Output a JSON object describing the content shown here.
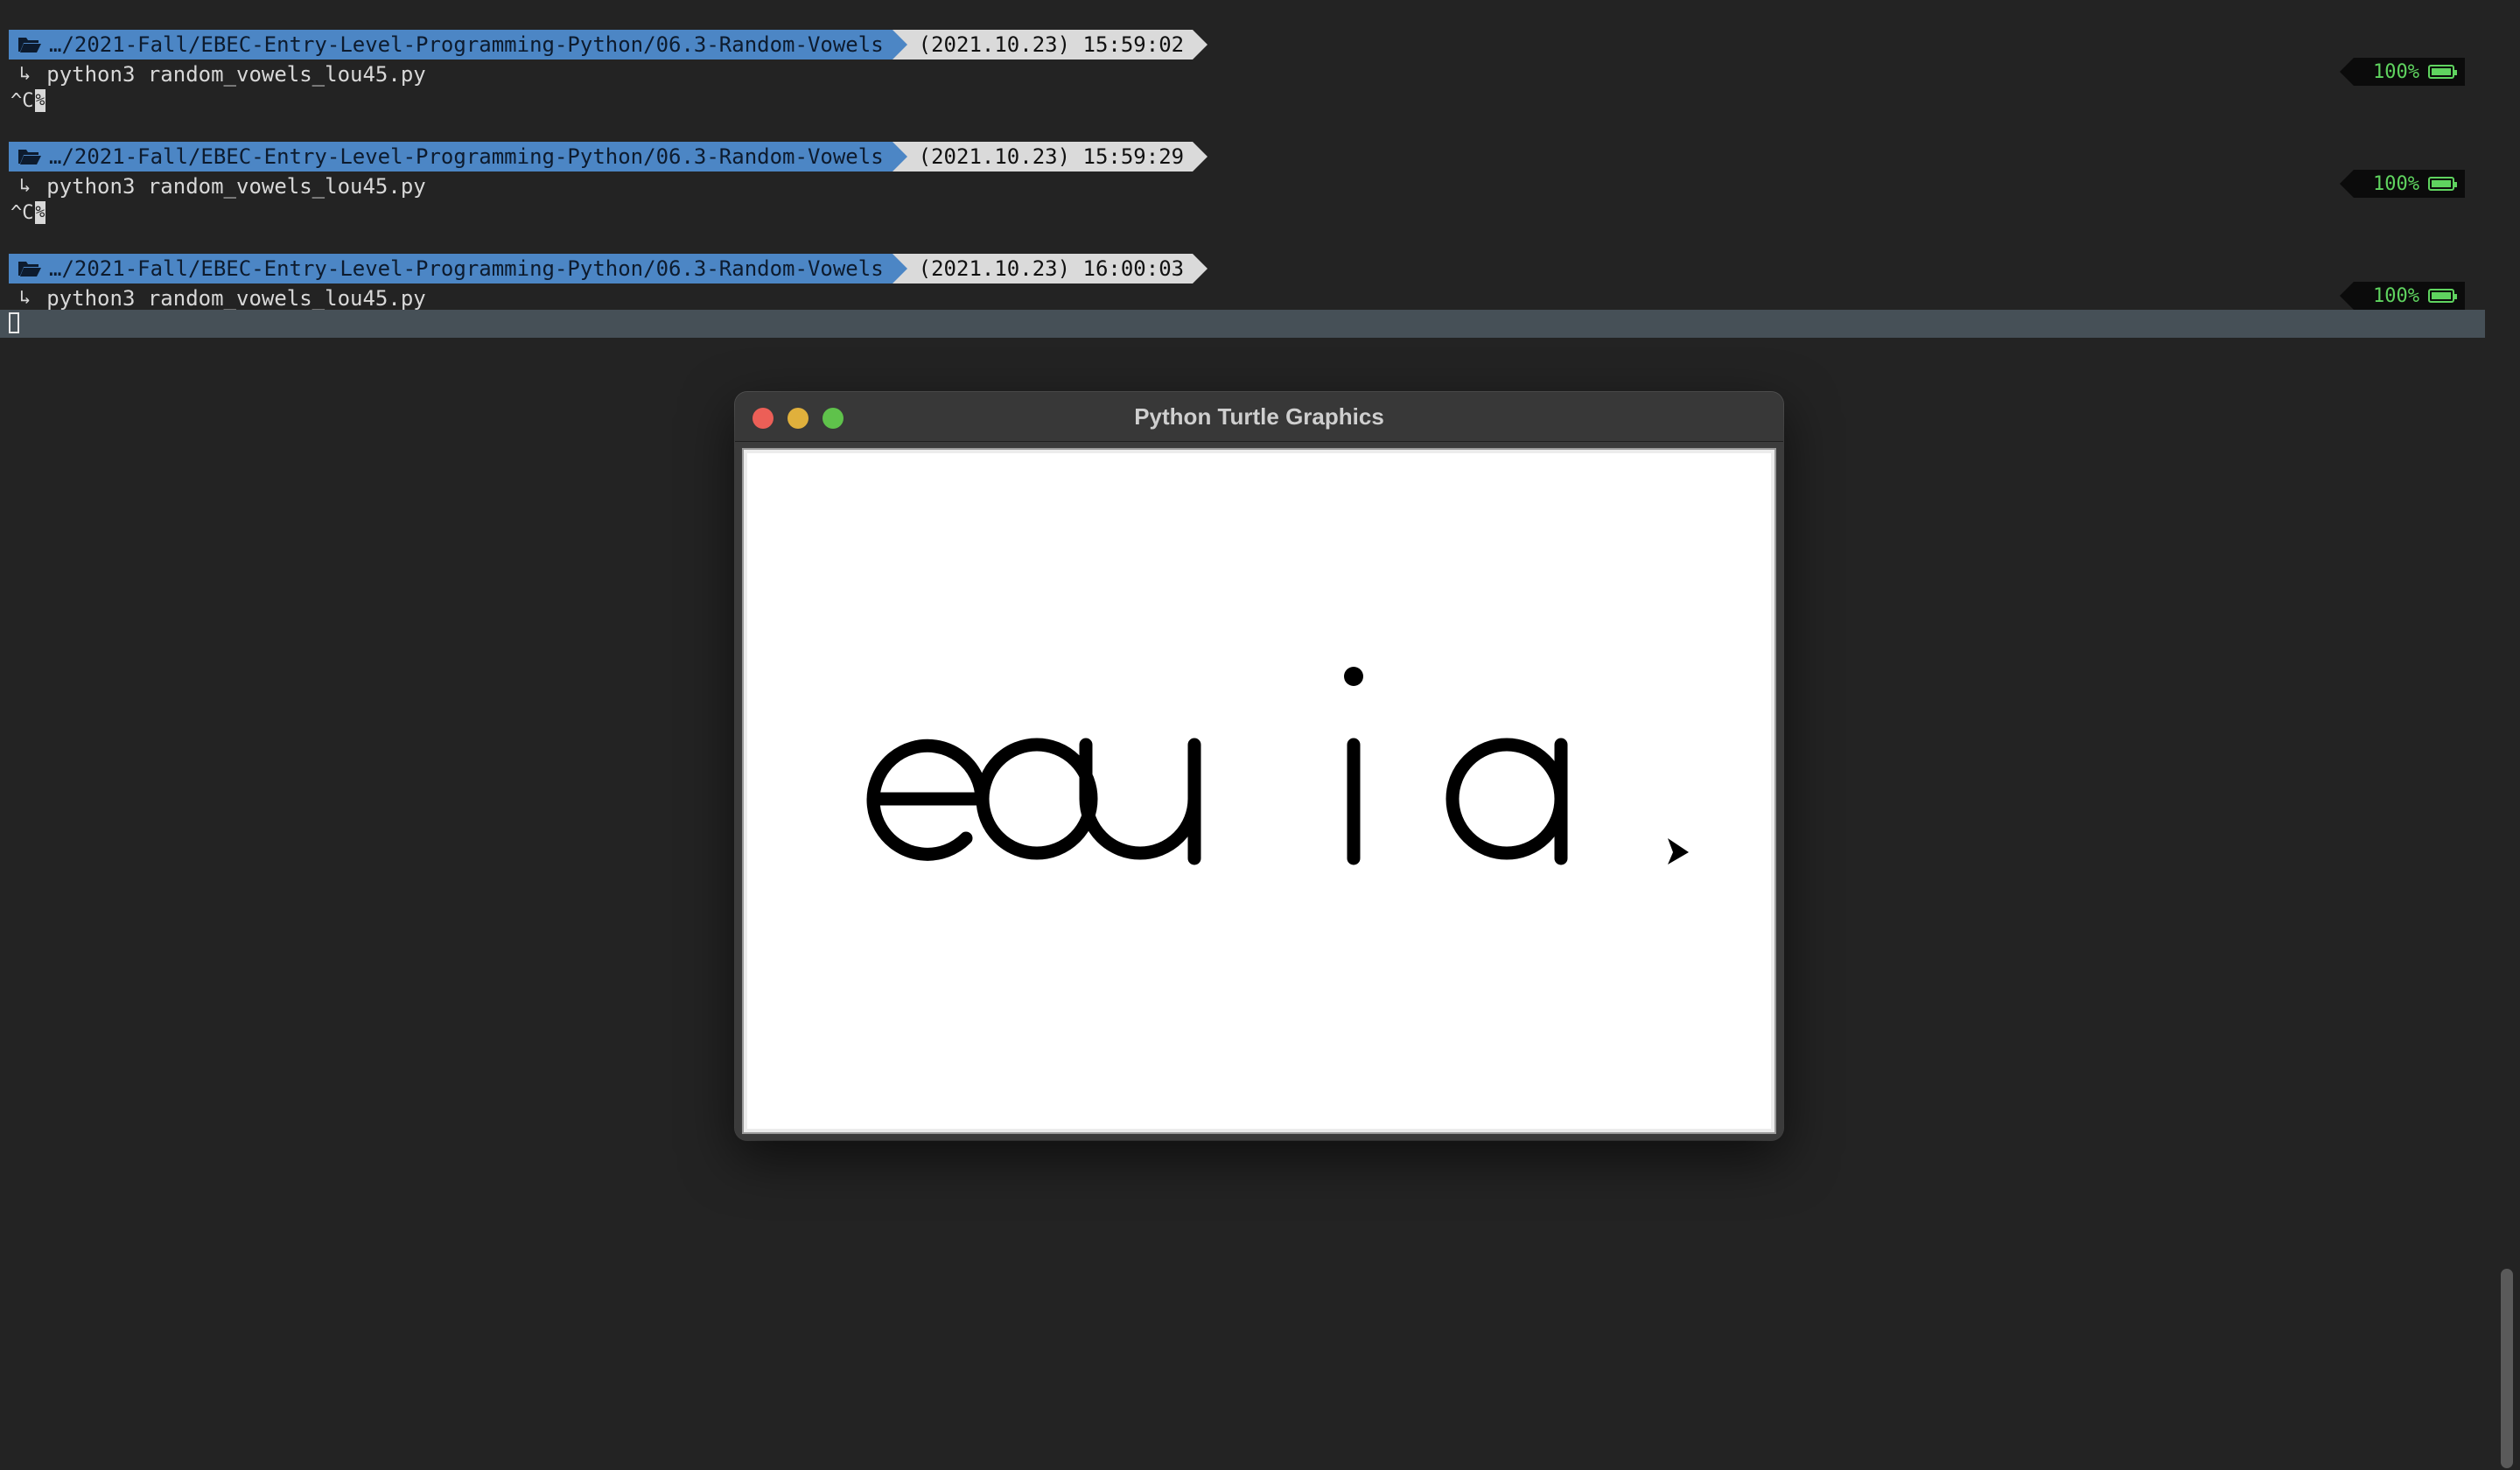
{
  "terminal": {
    "blocks": [
      {
        "path": "…/2021-Fall/EBEC-Entry-Level-Programming-Python/06.3-Random-Vowels",
        "timestamp": "(2021.10.23) 15:59:02",
        "command": "python3 random_vowels_lou45.py",
        "interrupt": "^C",
        "interrupt_cursor": "%",
        "battery": "100%"
      },
      {
        "path": "…/2021-Fall/EBEC-Entry-Level-Programming-Python/06.3-Random-Vowels",
        "timestamp": "(2021.10.23) 15:59:29",
        "command": "python3 random_vowels_lou45.py",
        "interrupt": "^C",
        "interrupt_cursor": "%",
        "battery": "100%"
      },
      {
        "path": "…/2021-Fall/EBEC-Entry-Level-Programming-Python/06.3-Random-Vowels",
        "timestamp": "(2021.10.23) 16:00:03",
        "command": "python3 random_vowels_lou45.py",
        "battery": "100%"
      }
    ],
    "continuation_arrow": "↳",
    "colors": {
      "background": "#232323",
      "path_segment": "#4c86c5",
      "time_segment": "#dadada",
      "battery_text": "#5fd35f",
      "input_line": "#465057"
    }
  },
  "turtle_window": {
    "title": "Python Turtle Graphics",
    "drawn_text": "eoui a",
    "letters": [
      "e",
      "o",
      "u",
      "i",
      "a"
    ],
    "turtle_cursor": "arrow-turtle"
  }
}
